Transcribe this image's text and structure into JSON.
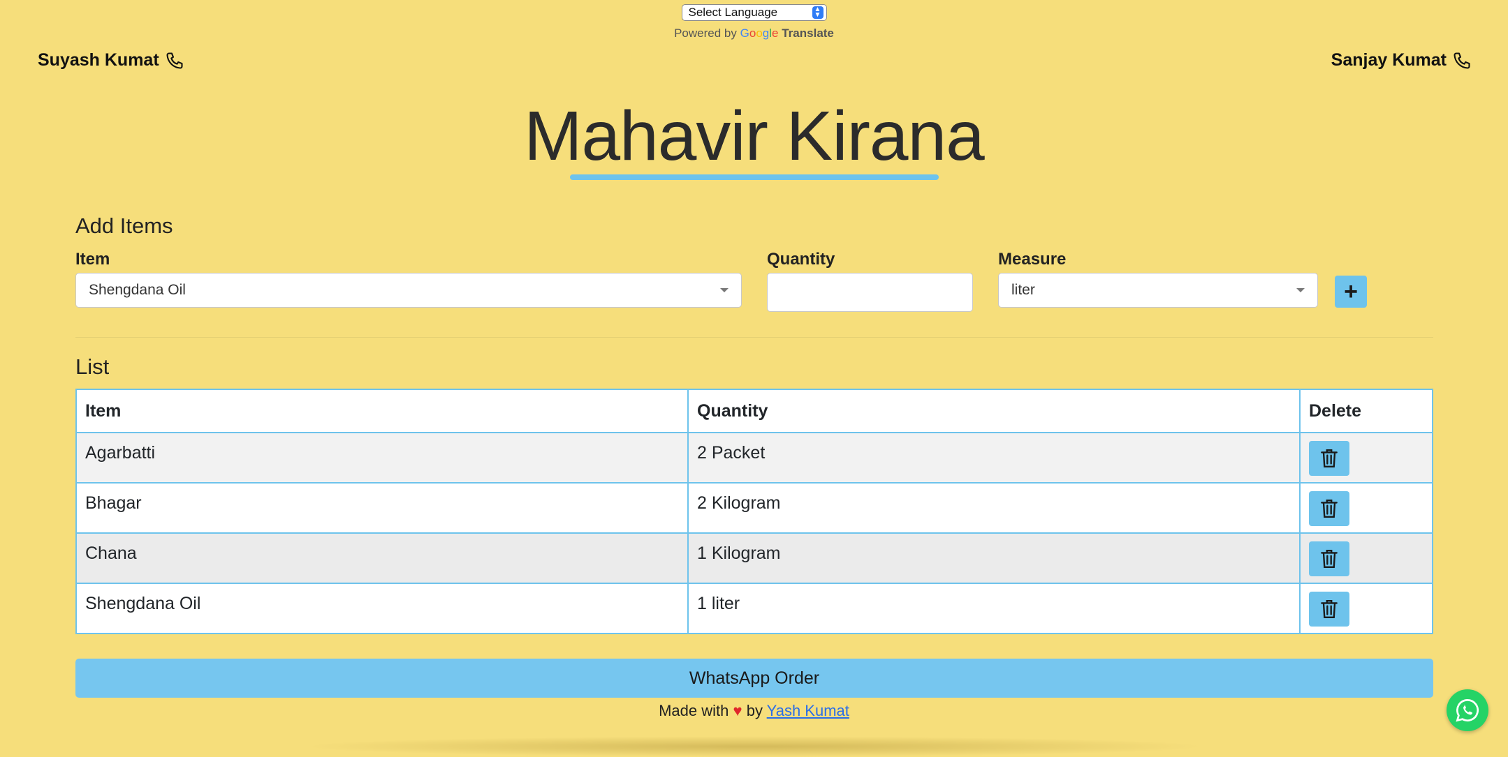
{
  "translate": {
    "select_label": "Select Language",
    "powered_by": "Powered by",
    "google_letters": [
      "G",
      "o",
      "o",
      "g",
      "l",
      "e"
    ],
    "translate_word": "Translate"
  },
  "contacts": {
    "left_name": "Suyash Kumat",
    "right_name": "Sanjay Kumat",
    "icon": "phone-icon"
  },
  "header": {
    "title": "Mahavir Kirana"
  },
  "add_items": {
    "heading": "Add Items",
    "item_label": "Item",
    "item_value": "Shengdana Oil",
    "quantity_label": "Quantity",
    "quantity_value": "",
    "measure_label": "Measure",
    "measure_value": "liter",
    "add_button": "+"
  },
  "list": {
    "heading": "List",
    "columns": [
      "Item",
      "Quantity",
      "Delete"
    ],
    "rows": [
      {
        "item": "Agarbatti",
        "quantity": "2 Packet"
      },
      {
        "item": "Bhagar",
        "quantity": "2 Kilogram"
      },
      {
        "item": "Chana",
        "quantity": "1 Kilogram"
      },
      {
        "item": "Shengdana Oil",
        "quantity": "1 liter"
      }
    ]
  },
  "order_button": "WhatsApp Order",
  "footer": {
    "made_with": "Made with",
    "heart": "♥",
    "by": "by",
    "author": "Yash Kumat"
  },
  "colors": {
    "background": "#f6de7b",
    "accent": "#6ec3ec",
    "whatsapp": "#25d366"
  }
}
